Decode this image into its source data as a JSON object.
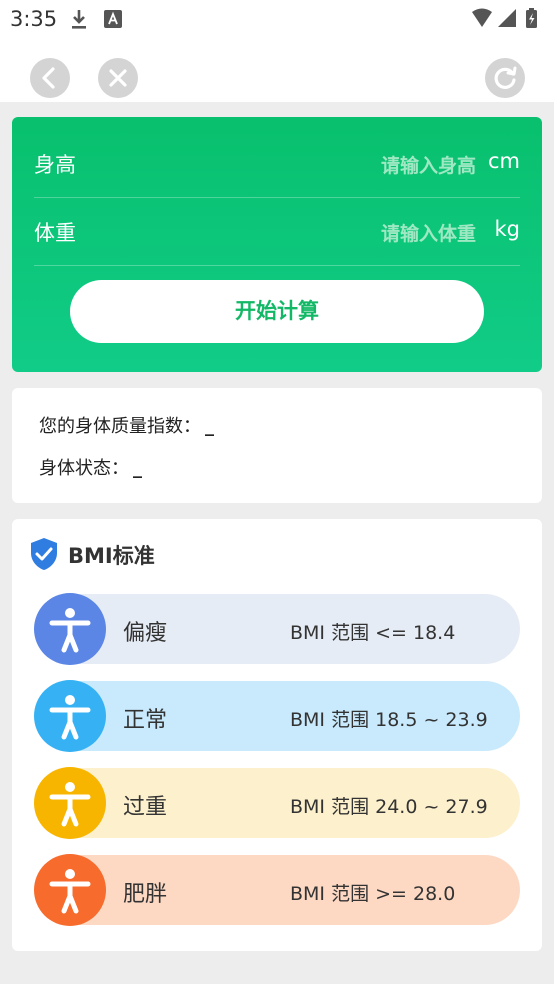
{
  "status": {
    "time": "3:35"
  },
  "form": {
    "height_label": "身高",
    "height_placeholder": "请输入身高",
    "height_unit": "cm",
    "weight_label": "体重",
    "weight_placeholder": "请输入体重",
    "weight_unit": "kg",
    "calc_label": "开始计算"
  },
  "result": {
    "bmi_label": "您的身体质量指数：",
    "bmi_value": "_",
    "status_label": "身体状态：",
    "status_value": "_"
  },
  "standard": {
    "title": "BMI标准",
    "rows": [
      {
        "name": "偏瘦",
        "range": "BMI 范围 <= 18.4",
        "icon": "person-icon",
        "circle_color": "#5b86e5",
        "pill_color": "#e6ecf5"
      },
      {
        "name": "正常",
        "range": "BMI 范围 18.5 ~ 23.9",
        "icon": "person-icon",
        "circle_color": "#36b2f4",
        "pill_color": "#c8eafc"
      },
      {
        "name": "过重",
        "range": "BMI 范围 24.0 ~ 27.9",
        "icon": "person-icon",
        "circle_color": "#f7b500",
        "pill_color": "#fdf0cc"
      },
      {
        "name": "肥胖",
        "range": "BMI 范围 >= 28.0",
        "icon": "person-icon",
        "circle_color": "#f76b2d",
        "pill_color": "#fdd9c4"
      }
    ]
  },
  "colors": {
    "accent": "#08c06d",
    "page_bg": "#ededed"
  }
}
